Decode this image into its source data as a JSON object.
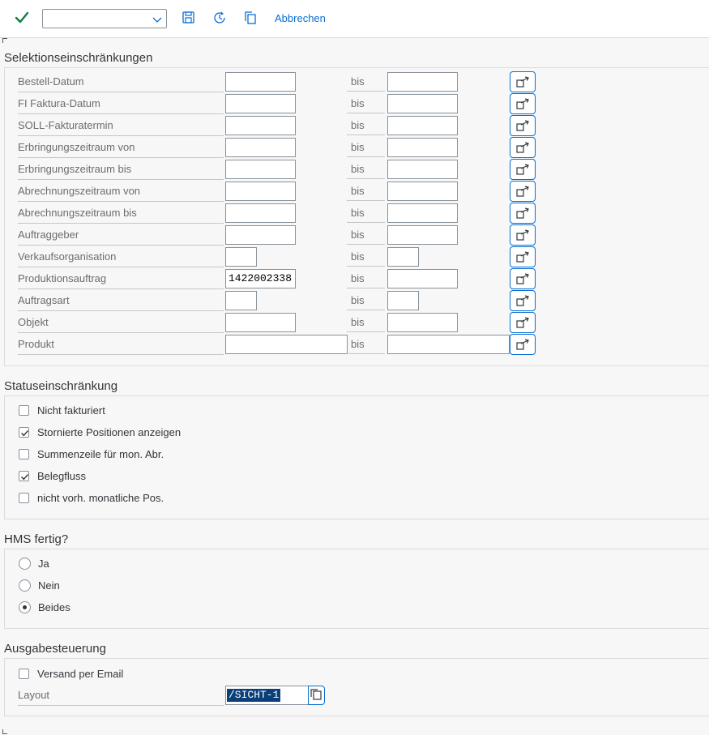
{
  "toolbar": {
    "variant_value": "",
    "cancel_label": "Abbrechen",
    "icons": [
      "execute-check-icon",
      "chevron-down-icon",
      "save-icon",
      "clock-icon",
      "copy-icon"
    ],
    "accent_color": "#0a6ed1"
  },
  "selection": {
    "title": "Selektionseinschränkungen",
    "bis_label": "bis",
    "rows": [
      {
        "label": "Bestell-Datum",
        "from": "",
        "to": ""
      },
      {
        "label": "FI Faktura-Datum",
        "from": "",
        "to": ""
      },
      {
        "label": "SOLL-Fakturatermin",
        "from": "",
        "to": ""
      },
      {
        "label": "Erbringungszeitraum von",
        "from": "",
        "to": ""
      },
      {
        "label": "Erbringungszeitraum bis",
        "from": "",
        "to": ""
      },
      {
        "label": "Abrechnungszeitraum von",
        "from": "",
        "to": ""
      },
      {
        "label": "Abrechnungszeitraum bis",
        "from": "",
        "to": ""
      },
      {
        "label": "Auftraggeber",
        "from": "",
        "to": ""
      },
      {
        "label": "Verkaufsorganisation",
        "from": "",
        "to": ""
      },
      {
        "label": "Produktionsauftrag",
        "from": "1422002338",
        "to": ""
      },
      {
        "label": "Auftragsart",
        "from": "",
        "to": ""
      },
      {
        "label": "Objekt",
        "from": "",
        "to": ""
      },
      {
        "label": "Produkt",
        "from": "",
        "to": ""
      }
    ]
  },
  "status": {
    "title": "Statuseinschränkung",
    "options": [
      {
        "label": "Nicht fakturiert",
        "checked": false
      },
      {
        "label": "Stornierte Positionen anzeigen",
        "checked": true
      },
      {
        "label": "Summenzeile für mon. Abr.",
        "checked": false
      },
      {
        "label": "Belegfluss",
        "checked": true
      },
      {
        "label": "nicht vorh. monatliche Pos.",
        "checked": false
      }
    ]
  },
  "hms": {
    "title": "HMS fertig?",
    "options": [
      {
        "label": "Ja",
        "selected": false
      },
      {
        "label": "Nein",
        "selected": false
      },
      {
        "label": "Beides",
        "selected": true
      }
    ]
  },
  "output": {
    "title": "Ausgabesteuerung",
    "email_label": "Versand per Email",
    "email_checked": false,
    "layout_label": "Layout",
    "layout_value": "/SICHT-1"
  }
}
